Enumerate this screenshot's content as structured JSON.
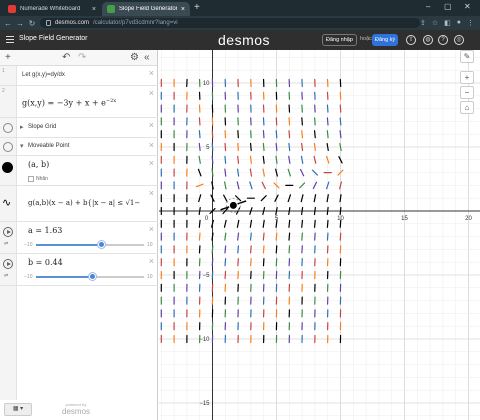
{
  "browser": {
    "tabs": [
      {
        "title": "Numerade Whiteboard",
        "active": false
      },
      {
        "title": "Slope Field Generator",
        "active": true
      }
    ],
    "url_host": "desmos.com",
    "url_path": "/calculator/p7vd3cdmnr?lang=vi"
  },
  "header": {
    "graph_title": "Slope Field Generator",
    "logo": "desmos",
    "login_label": "Đăng nhập",
    "or_label": "hoặc",
    "signup_label": "Đăng ký",
    "help_icon": "?"
  },
  "expressions": {
    "e1": {
      "index": "1",
      "text": "Let g(x,y)=dy/dx"
    },
    "e2": {
      "index": "2",
      "latex": "g(x,y) = −3y + x + e",
      "exp": "−2x"
    },
    "f1": {
      "label": "Slope Grid"
    },
    "f2": {
      "label": "Moveable Point"
    },
    "e5": {
      "latex": "(a, b)",
      "label_checkbox": "Nhãn"
    },
    "e6": {
      "latex": "g(a,b)(x − a) + b{|x − a| ≤ ",
      "sqrt": "√1−"
    },
    "e7": {
      "latex": "a = 1.63",
      "min": "−10",
      "max": "10",
      "value": 1.63
    },
    "e8": {
      "latex": "b = 0.44",
      "min": "−10",
      "max": "10",
      "value": 0.44
    }
  },
  "bottom": {
    "keyboard": "▦ ▾",
    "powered_by": "powered by",
    "brand": "desmos"
  },
  "graph": {
    "x_ticks": [
      "−5",
      "0",
      "5",
      "10",
      "15",
      "20"
    ],
    "y_ticks": [
      "10",
      "5",
      "−5",
      "−10",
      "−15"
    ],
    "point": {
      "a": 1.63,
      "b": 0.44
    }
  },
  "colors": {
    "red": "#c74440",
    "blue": "#2d70b3",
    "green": "#388c46",
    "purple": "#6042a6",
    "orange": "#fa7e19",
    "black": "#000000"
  }
}
